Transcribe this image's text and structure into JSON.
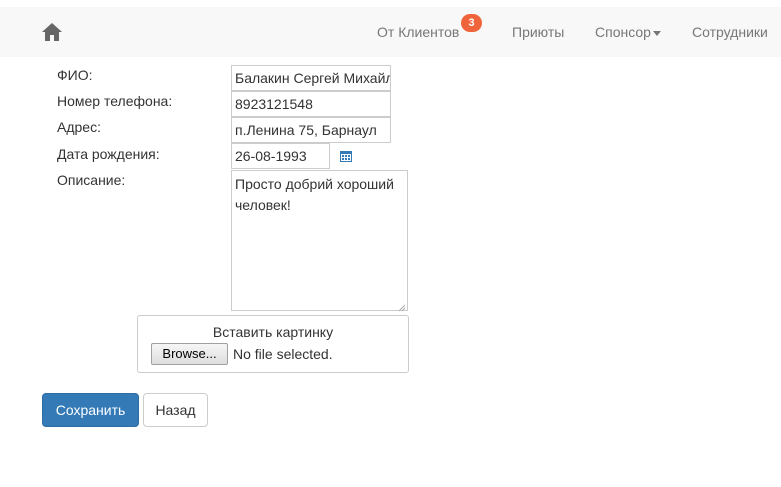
{
  "navbar": {
    "home_icon": "home-icon",
    "items": [
      {
        "label": "От Клиентов",
        "badge": "3"
      },
      {
        "label": "Приюты"
      },
      {
        "label": "Спонсор",
        "dropdown": true
      },
      {
        "label": "Сотрудники"
      }
    ],
    "colors": {
      "background": "#f8f8f8",
      "text": "#777777",
      "badge": "#f0643c"
    }
  },
  "form": {
    "fields": {
      "fio": {
        "label": "ФИО:",
        "value": "Балакин Сергей Михайлович"
      },
      "phone": {
        "label": "Номер телефона:",
        "value": "8923121548"
      },
      "address": {
        "label": "Адрес:",
        "value": "п.Ленина 75, Барнаул"
      },
      "birth_date": {
        "label": "Дата рождения:",
        "value": "26-08-1993",
        "icon": "calendar-icon"
      },
      "description": {
        "label": "Описание:",
        "value": "Просто добрий хороший человек!"
      }
    },
    "upload": {
      "title": "Вставить картинку",
      "browse_label": "Browse...",
      "status": "No file selected."
    },
    "buttons": {
      "save_label": "Сохранить",
      "back_label": "Назад"
    },
    "colors": {
      "primary": "#337ab7",
      "border": "#cccccc"
    }
  }
}
